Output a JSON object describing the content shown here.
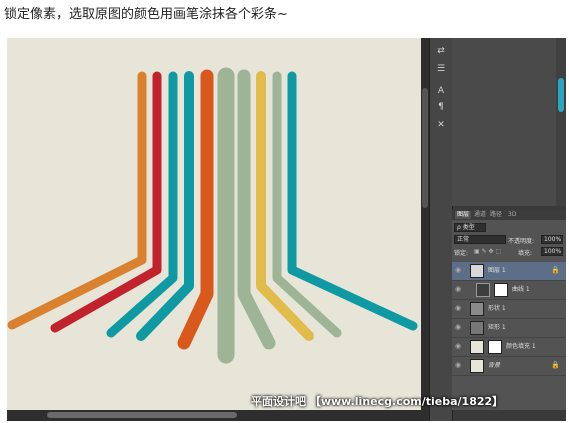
{
  "caption": "锁定像素，选取原图的颜色用画笔涂抹各个彩条~",
  "colors": {
    "canvas_bg": "#e6e5d8",
    "stripes": [
      "#d9812f",
      "#c2222b",
      "#0f9aa3",
      "#0f9aa3",
      "#d9581c",
      "#9db596",
      "#9db596",
      "#e1bc4a",
      "#9db596",
      "#0f9aa3"
    ]
  },
  "toolbar": {
    "icons": [
      "arrows-icon",
      "sliders-icon",
      "text-icon",
      "paragraph-icon",
      "tools-icon"
    ]
  },
  "layers_panel": {
    "tabs": [
      "图层",
      "通道",
      "路径",
      "3D"
    ],
    "filter_label": "类型",
    "blend_mode": "正常",
    "opacity_label": "不透明度:",
    "opacity_value": "100%",
    "lock_label": "锁定:",
    "fill_label": "填充:",
    "fill_value": "100%",
    "layers": [
      {
        "name": "图层 1",
        "selected": true
      },
      {
        "name": "曲线 1",
        "selected": false
      },
      {
        "name": "形状 1",
        "selected": false
      },
      {
        "name": "矩形 1",
        "selected": false
      },
      {
        "name": "颜色填充 1",
        "selected": false
      },
      {
        "name": "背景",
        "selected": false
      }
    ]
  },
  "watermark": "平面设计吧 【www.linecg.com/tieba/1822】"
}
